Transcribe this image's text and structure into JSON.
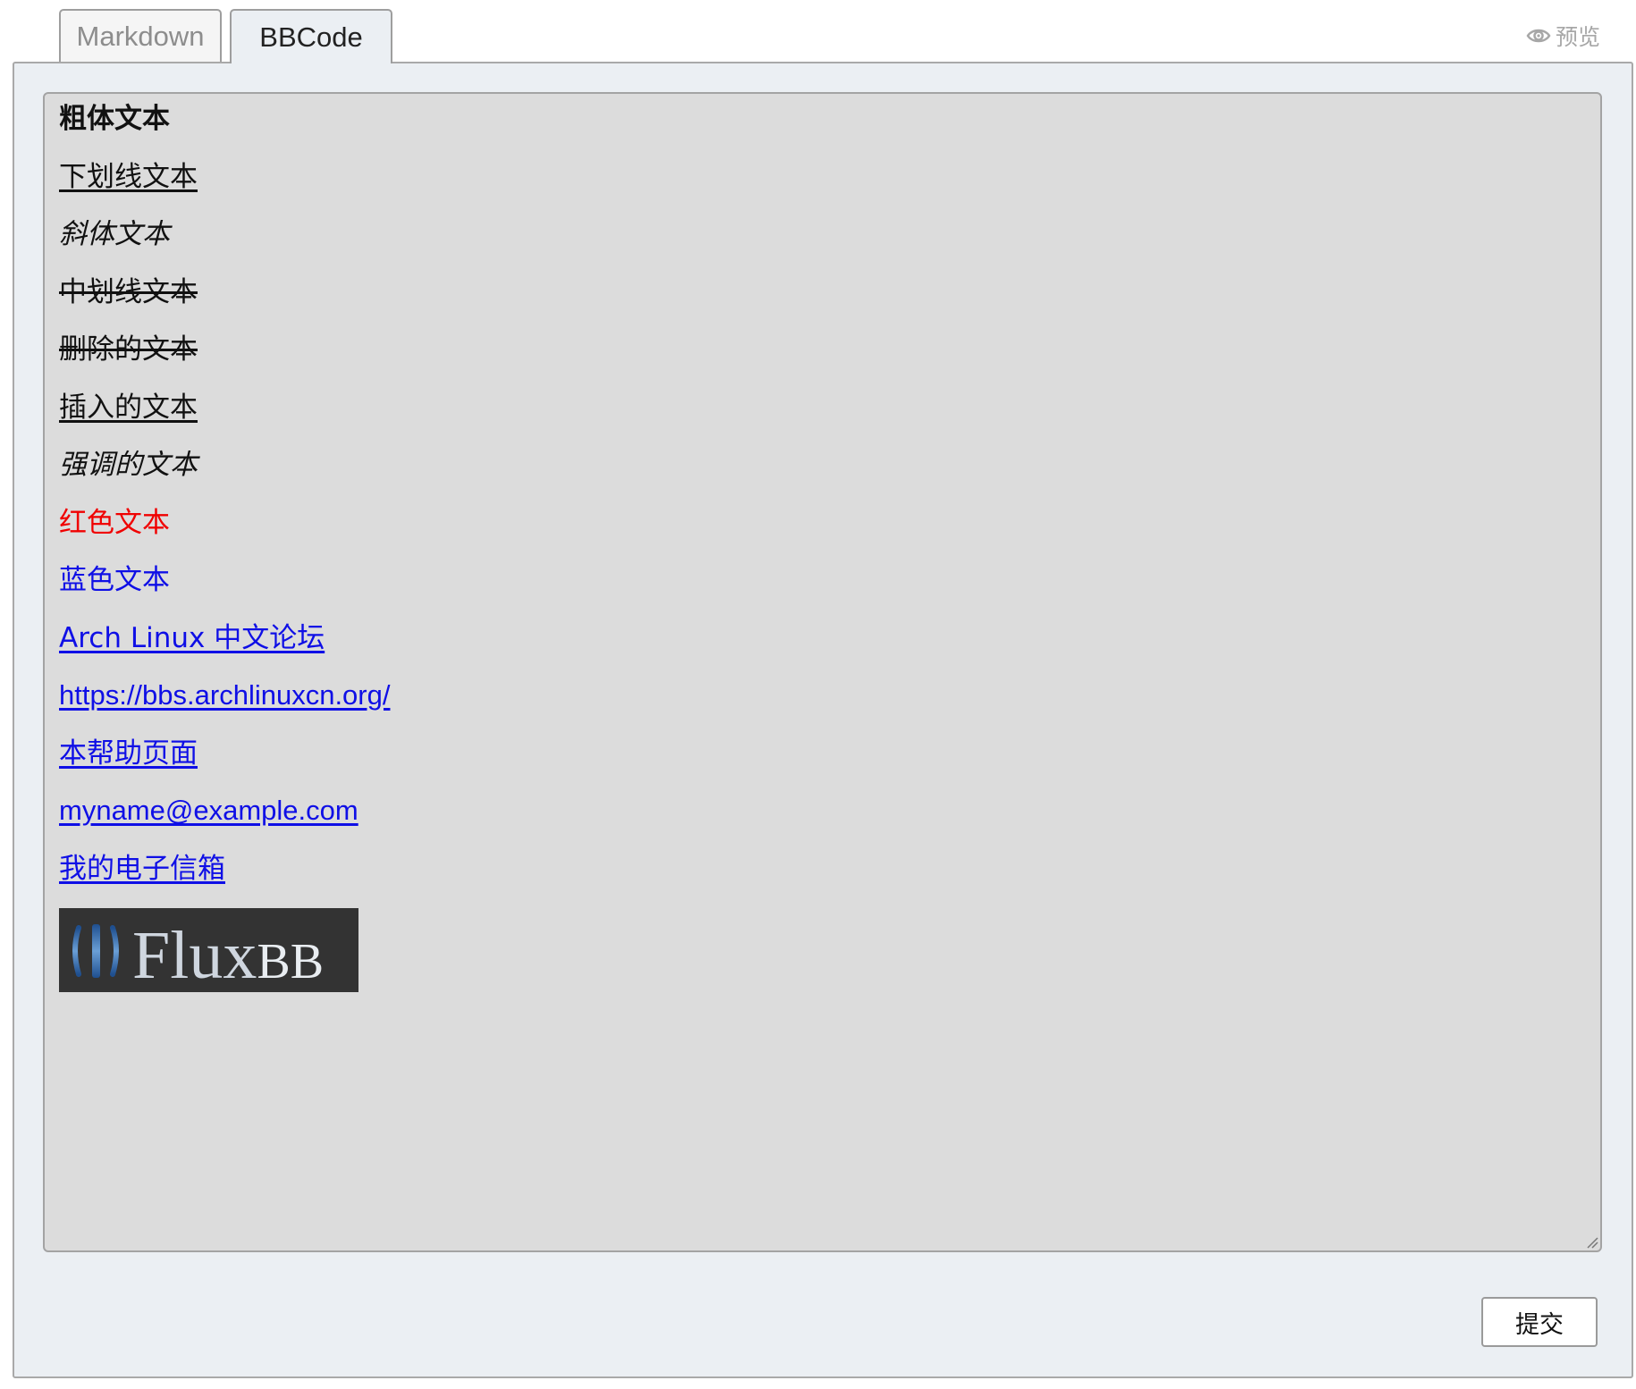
{
  "tabs": [
    {
      "label": "Markdown",
      "active": false
    },
    {
      "label": "BBCode",
      "active": true
    }
  ],
  "preview": {
    "label": "预览",
    "icon": "eye-icon"
  },
  "editor": {
    "lines": {
      "bold": "粗体文本",
      "underline": "下划线文本",
      "italic": "斜体文本",
      "strikethrough": "中划线文本",
      "deleted": "删除的文本",
      "inserted": "插入的文本",
      "emphasis": "强调的文本",
      "red": "红色文本",
      "blue": "蓝色文本",
      "link_named": "Arch Linux 中文论坛",
      "link_url": "https://bbs.archlinuxcn.org/",
      "link_help": "本帮助页面",
      "email": "myname@example.com",
      "email_named": "我的电子信箱"
    },
    "image": {
      "logo_text_main": "Flux",
      "logo_text_suffix": "BB"
    }
  },
  "submit": {
    "label": "提交"
  },
  "colors": {
    "red_text": "#f00000",
    "blue_text": "#0f0fe6",
    "panel_bg": "#ebeff3",
    "editor_bg": "#dcdcdc"
  }
}
